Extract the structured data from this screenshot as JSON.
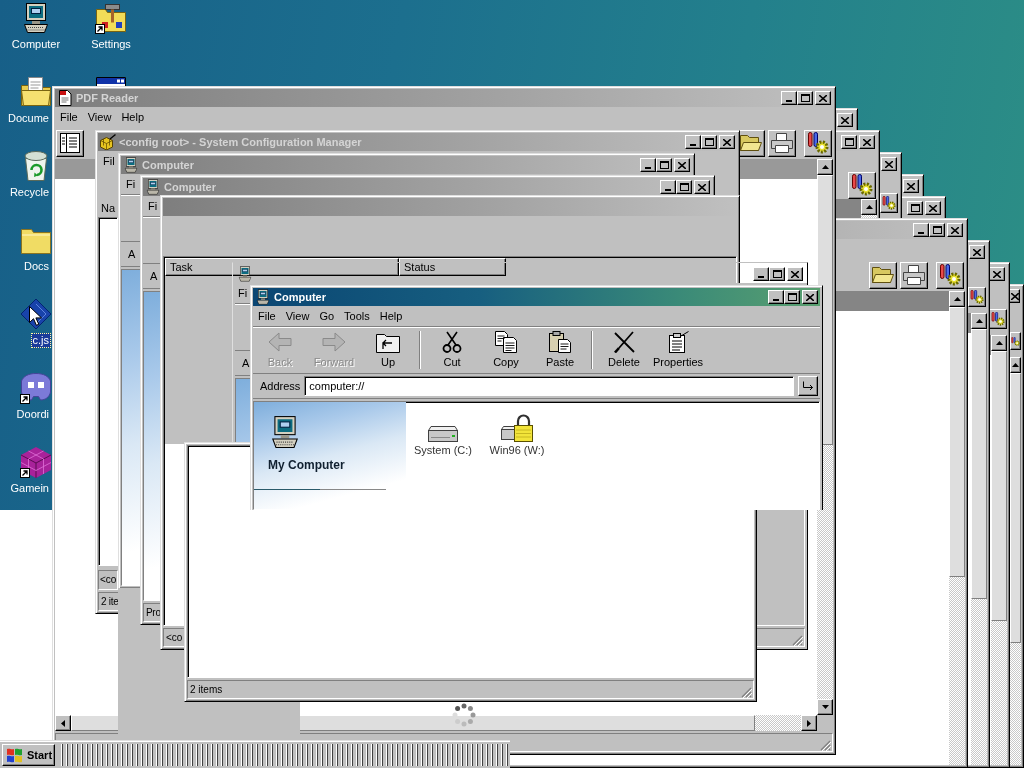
{
  "desktop_icons": [
    {
      "kind": "computer",
      "label": "Computer",
      "selected": false,
      "shortcut": false
    },
    {
      "kind": "documents",
      "label": "Docume",
      "selected": false,
      "shortcut": false
    },
    {
      "kind": "recycle",
      "label": "Recycle",
      "selected": false,
      "shortcut": false
    },
    {
      "kind": "folder",
      "label": "Docs",
      "selected": false,
      "shortcut": false
    },
    {
      "kind": "script",
      "label": "c.js",
      "selected": true,
      "shortcut": false
    },
    {
      "kind": "chat",
      "label": "Doordi",
      "selected": false,
      "shortcut": true
    },
    {
      "kind": "game",
      "label": "Gamein",
      "selected": false,
      "shortcut": true
    },
    {
      "kind": "settings",
      "label": "Settings",
      "selected": false,
      "shortcut": true
    },
    {
      "kind": "program",
      "selected": false,
      "shortcut": false
    }
  ],
  "windows": [
    {
      "kind": "ghost",
      "active": false,
      "title_buttons": [
        {
          "kind": "close"
        }
      ]
    },
    {
      "kind": "ghost",
      "active": false,
      "title_buttons": [
        {
          "kind": "maximize"
        },
        {
          "kind": "close"
        }
      ],
      "tools": [
        {
          "kind": "settings"
        }
      ]
    },
    {
      "kind": "ghost",
      "active": false,
      "title_buttons": [
        {
          "kind": "close"
        }
      ],
      "tools": [
        {
          "kind": "settings"
        }
      ]
    },
    {
      "kind": "ghost",
      "active": false,
      "title_buttons": [
        {
          "kind": "close"
        }
      ]
    },
    {
      "kind": "ghost",
      "active": false,
      "title_buttons": [
        {
          "kind": "maximize"
        },
        {
          "kind": "close"
        }
      ]
    },
    {
      "kind": "ghost",
      "active": false,
      "title_buttons": [
        {
          "kind": "minimize"
        },
        {
          "kind": "maximize"
        },
        {
          "kind": "close"
        }
      ],
      "tools": [
        {
          "kind": "open"
        },
        {
          "kind": "print"
        },
        {
          "kind": "settings"
        }
      ]
    },
    {
      "kind": "ghost",
      "active": false,
      "title_buttons": [
        {
          "kind": "close"
        }
      ],
      "tools": [
        {
          "kind": "settings"
        }
      ]
    },
    {
      "kind": "ghost",
      "active": false,
      "title_buttons": [
        {
          "kind": "close"
        }
      ],
      "tools": [
        {
          "kind": "settings"
        }
      ]
    },
    {
      "kind": "ghost",
      "active": false,
      "title_buttons": [
        {
          "kind": "close"
        }
      ],
      "tools": [
        {
          "kind": "settings"
        }
      ]
    },
    {
      "kind": "reader",
      "title": "PDF Reader",
      "active": false,
      "icon": true,
      "title_buttons": [
        {
          "kind": "minimize"
        },
        {
          "kind": "maximize"
        },
        {
          "kind": "close"
        }
      ],
      "menu": [
        "File",
        "View",
        "Help"
      ],
      "tools": [
        {
          "kind": "sidebar"
        },
        {
          "kind": "open"
        },
        {
          "kind": "print"
        },
        {
          "kind": "settings"
        }
      ]
    },
    {
      "kind": "config",
      "title": "<config root> - System Configuration Manager",
      "active": false,
      "icon": true,
      "title_buttons": [
        {
          "kind": "minimize"
        },
        {
          "kind": "maximize"
        },
        {
          "kind": "close"
        }
      ],
      "menu": [
        "Fil"
      ],
      "list_label": "Na",
      "path": "<co",
      "status": "2 ite"
    },
    {
      "kind": "explorer",
      "title": "Computer",
      "active": false,
      "icon": true,
      "title_buttons": [
        {
          "kind": "minimize"
        },
        {
          "kind": "maximize"
        },
        {
          "kind": "close"
        }
      ],
      "menu": [
        "Fi"
      ],
      "address_label": "A"
    },
    {
      "kind": "fragment"
    },
    {
      "kind": "explorer",
      "title": "Computer",
      "active": false,
      "icon": true,
      "title_buttons": [
        {
          "kind": "minimize"
        },
        {
          "kind": "maximize"
        },
        {
          "kind": "close"
        }
      ],
      "menu": [
        "Fi"
      ],
      "address_label": "A",
      "status": "Pro"
    },
    {
      "kind": "tasks",
      "active": false,
      "columns": [
        "Task",
        "Status"
      ],
      "status": "<co"
    },
    {
      "kind": "explorer",
      "titlebar_painted": false,
      "icon": true,
      "title_buttons": [
        {
          "kind": "minimize"
        },
        {
          "kind": "maximize"
        },
        {
          "kind": "close"
        }
      ],
      "menu": [
        "Fi"
      ],
      "address_label": "A"
    },
    {
      "kind": "blank",
      "status": "2 items"
    },
    {
      "kind": "explorer",
      "title": "Computer",
      "active": true,
      "icon": true,
      "title_buttons": [
        {
          "kind": "minimize"
        },
        {
          "kind": "maximize"
        },
        {
          "kind": "close"
        }
      ],
      "menu": [
        "File",
        "View",
        "Go",
        "Tools",
        "Help"
      ],
      "toolbar": [
        [
          {
            "kind": "back",
            "label": "Back",
            "disabled": true
          },
          {
            "kind": "forward",
            "label": "Forward",
            "disabled": true
          },
          {
            "kind": "up",
            "label": "Up",
            "disabled": false
          }
        ],
        [
          {
            "kind": "cut",
            "label": "Cut",
            "disabled": false
          },
          {
            "kind": "copy",
            "label": "Copy",
            "disabled": false
          },
          {
            "kind": "paste",
            "label": "Paste",
            "disabled": false
          }
        ],
        [
          {
            "kind": "delete",
            "label": "Delete",
            "disabled": false
          },
          {
            "kind": "properties",
            "label": "Properties",
            "disabled": false
          }
        ]
      ],
      "address_label": "Address",
      "address": "computer://",
      "pane_title": "My Computer",
      "items": [
        {
          "kind": "drive",
          "label": "System (C:)",
          "selected": false
        },
        {
          "kind": "locked-drive",
          "label": "Win96 (W:)",
          "selected": false
        }
      ]
    }
  ],
  "taskbar": {
    "start": "Start"
  }
}
